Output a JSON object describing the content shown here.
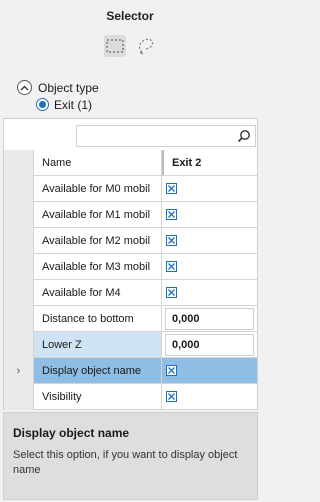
{
  "header": {
    "title": "Selector"
  },
  "tools": [
    {
      "icon": "rectangle-select-icon",
      "active": true
    },
    {
      "icon": "lasso-select-icon",
      "active": false
    }
  ],
  "object_type": {
    "label": "Object type",
    "option": "Exit (1)"
  },
  "search": {
    "placeholder": ""
  },
  "grid": {
    "header": {
      "name": "Name",
      "value": "Exit 2"
    },
    "rows": [
      {
        "name": "Available for M0 mobil",
        "type": "checkbox",
        "checked": true
      },
      {
        "name": "Available for M1 mobil",
        "type": "checkbox",
        "checked": true
      },
      {
        "name": "Available for M2 mobil",
        "type": "checkbox",
        "checked": true
      },
      {
        "name": "Available for M3 mobil",
        "type": "checkbox",
        "checked": true
      },
      {
        "name": "Available for M4",
        "type": "checkbox",
        "checked": true
      },
      {
        "name": "Distance to bottom",
        "type": "number",
        "value": "0,000"
      },
      {
        "name": "Lower Z",
        "type": "number",
        "value": "0,000"
      },
      {
        "name": "Display object name",
        "type": "checkbox",
        "checked": true,
        "selected_marker": "›"
      },
      {
        "name": "Visibility",
        "type": "checkbox",
        "checked": true
      }
    ]
  },
  "description": {
    "title": "Display object name",
    "text": "Select this option, if you want to display object name"
  }
}
